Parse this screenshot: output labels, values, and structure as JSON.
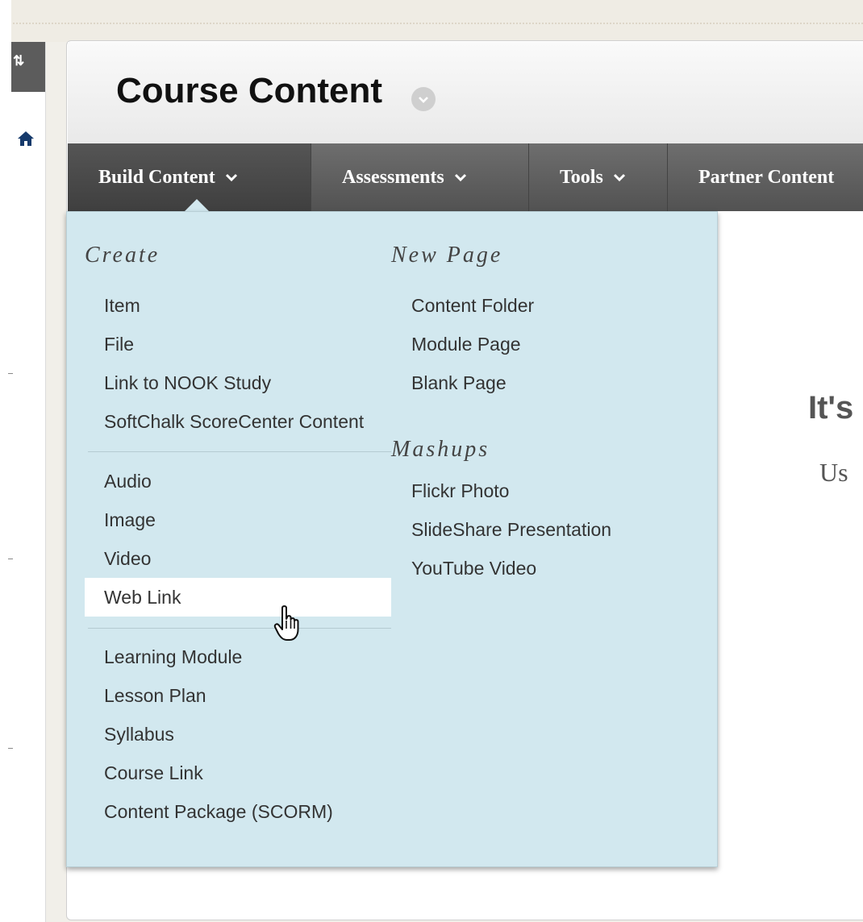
{
  "left_rail": {
    "sort_icon_text": "⇅"
  },
  "header": {
    "title": "Course Content"
  },
  "navbar": {
    "items": [
      {
        "label": "Build Content",
        "active": true
      },
      {
        "label": "Assessments",
        "active": false
      },
      {
        "label": "Tools",
        "active": false
      },
      {
        "label": "Partner Content",
        "active": false
      }
    ]
  },
  "dropdown": {
    "create": {
      "title": "Create",
      "group1": [
        "Item",
        "File",
        "Link to NOOK Study",
        "SoftChalk ScoreCenter Content"
      ],
      "group2": [
        "Audio",
        "Image",
        "Video",
        "Web Link"
      ],
      "group3": [
        "Learning Module",
        "Lesson Plan",
        "Syllabus",
        "Course Link",
        "Content Package (SCORM)"
      ]
    },
    "new_page": {
      "title": "New Page",
      "items": [
        "Content Folder",
        "Module Page",
        "Blank Page"
      ]
    },
    "mashups": {
      "title": "Mashups",
      "items": [
        "Flickr Photo",
        "SlideShare Presentation",
        "YouTube Video"
      ]
    },
    "highlighted_item": "Web Link"
  },
  "background_content": {
    "heading_partial": "It's",
    "text_partial": "Us"
  },
  "colors": {
    "menu_bg": "#d2e8ef",
    "nav_bg": "#5a5a5a",
    "highlight": "#ffffff"
  }
}
